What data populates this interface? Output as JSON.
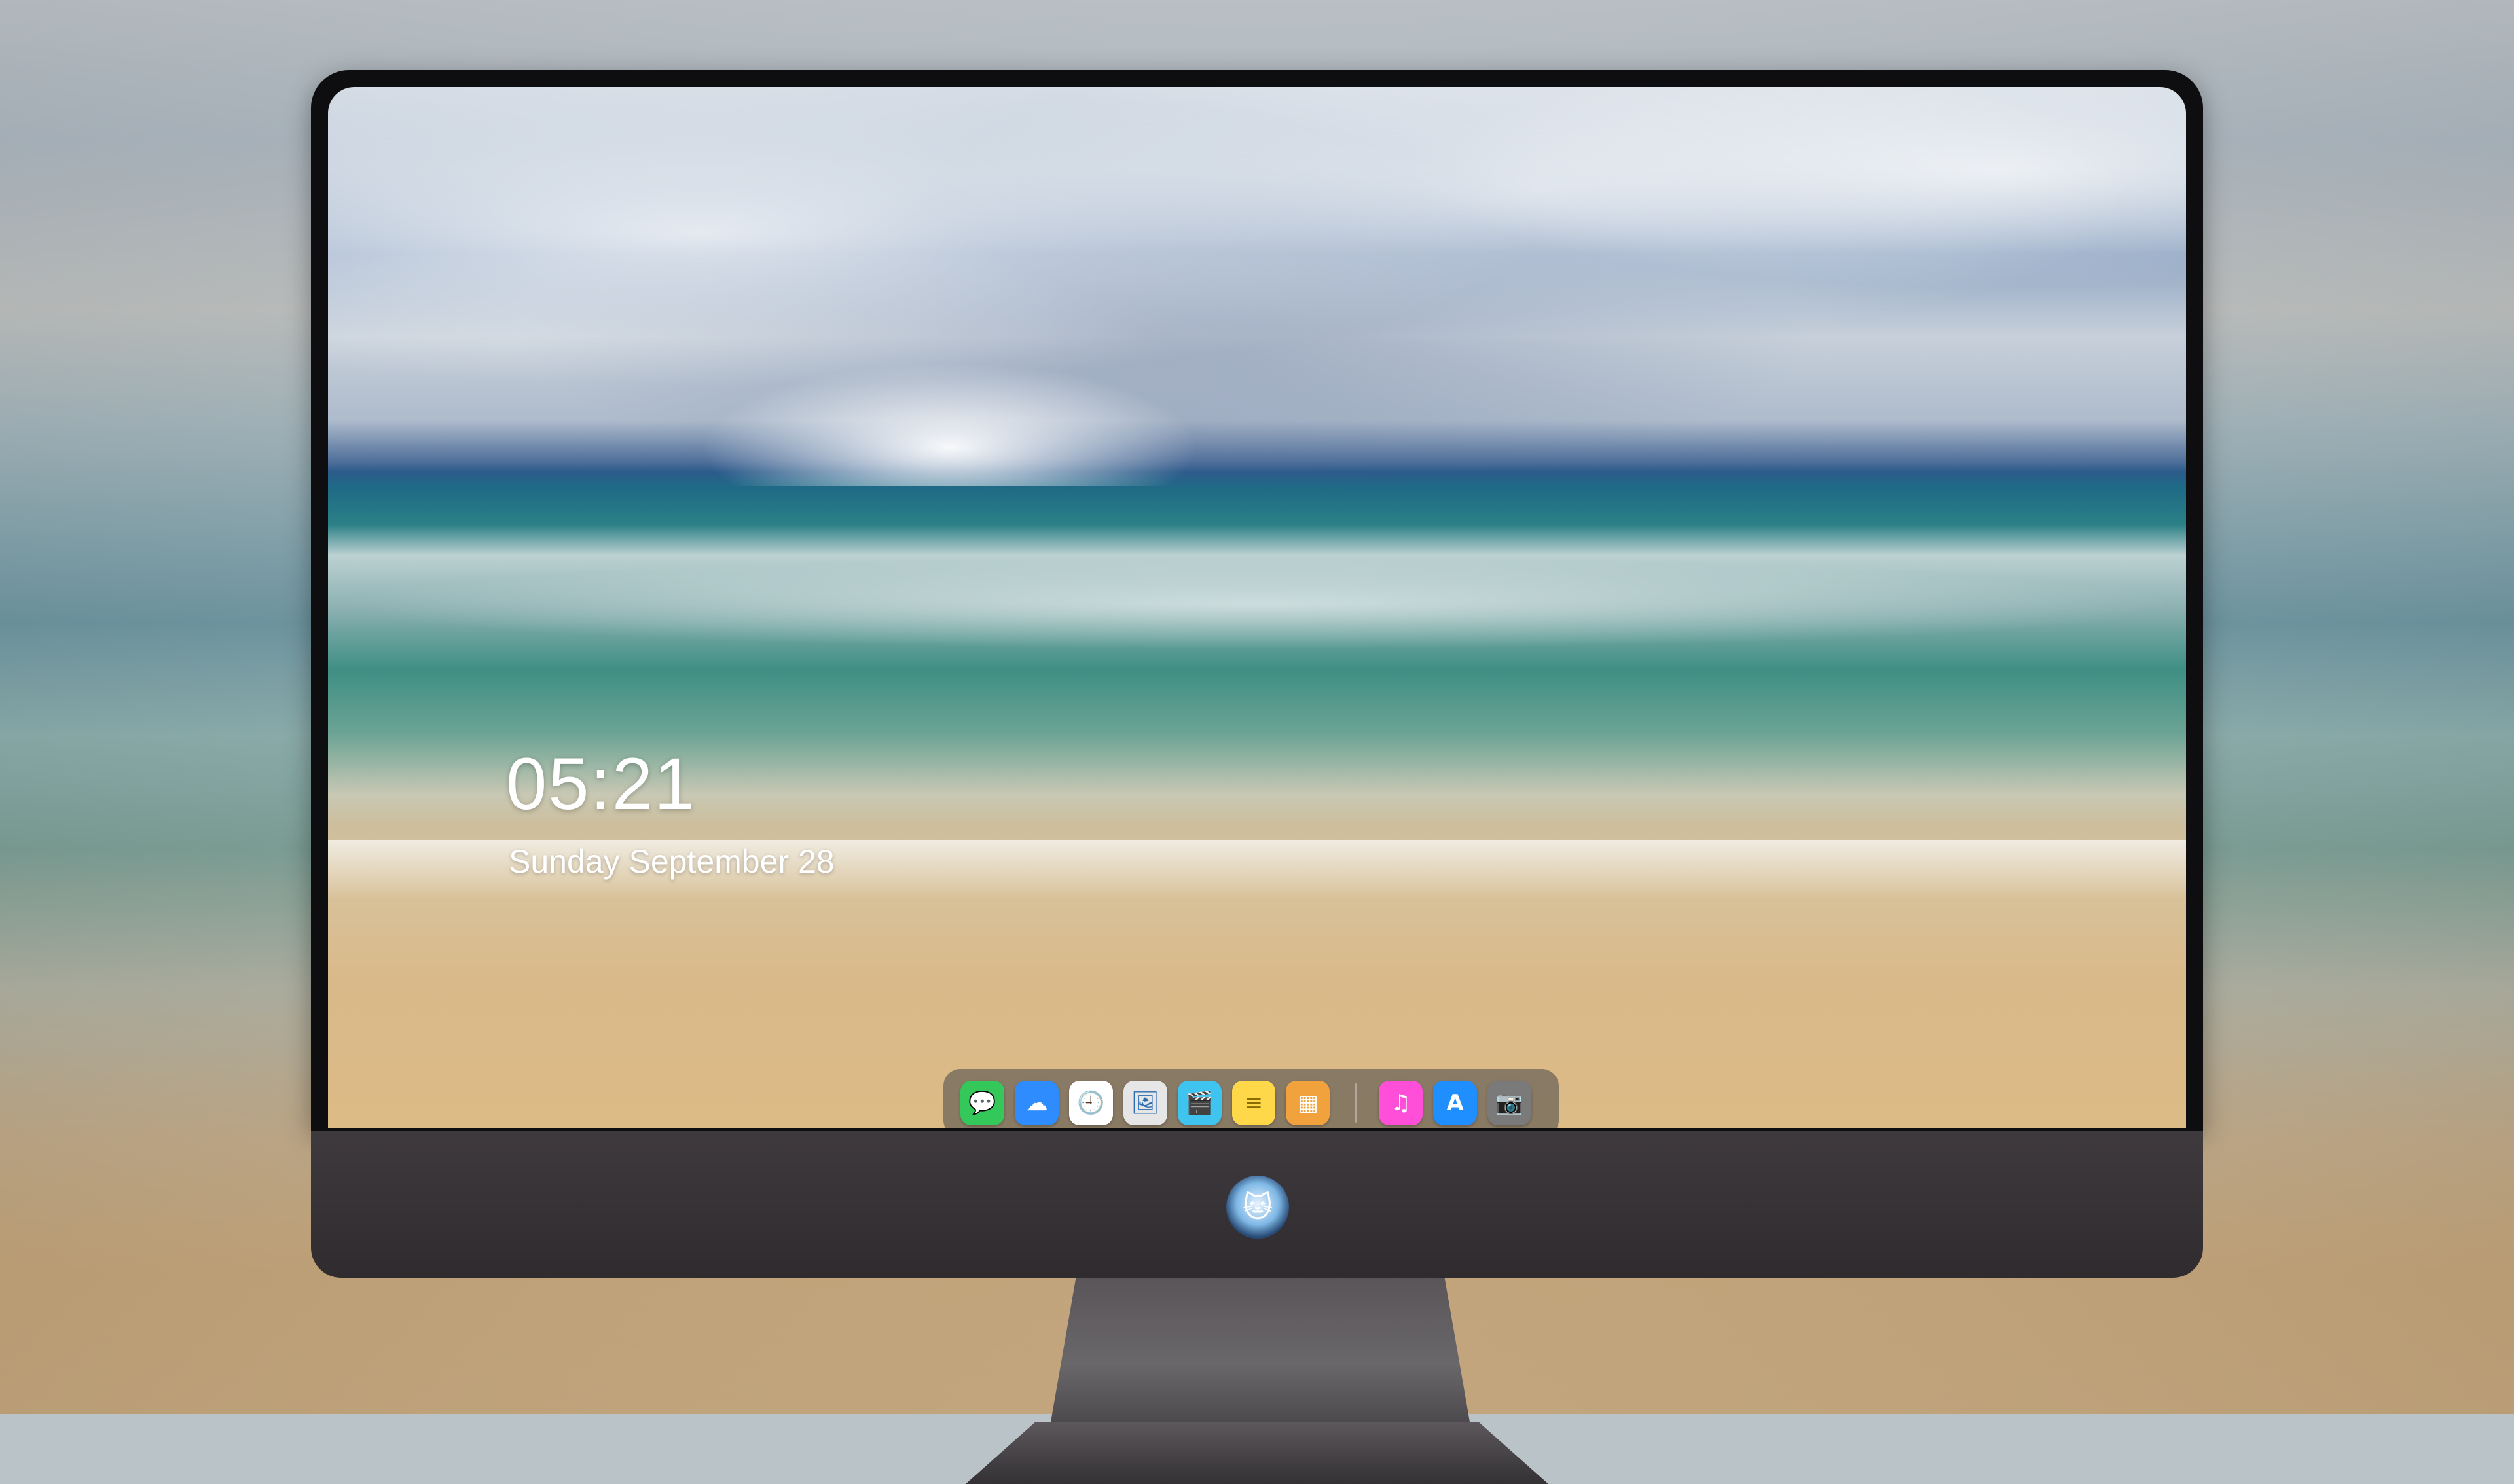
{
  "lock_screen": {
    "time": "05:21",
    "date": "Sunday September 28"
  },
  "dock": {
    "apps": [
      {
        "name": "Messages",
        "icon": "messages-icon",
        "glyph": "💬",
        "color": "#34c759"
      },
      {
        "name": "Weather",
        "icon": "weather-icon",
        "glyph": "☁",
        "color": "#2f8cff"
      },
      {
        "name": "Clock",
        "icon": "clock-icon",
        "glyph": "🕘",
        "color": "#ffffff"
      },
      {
        "name": "Preview",
        "icon": "preview-icon",
        "glyph": "🖼",
        "color": "#e6e6e6"
      },
      {
        "name": "Video",
        "icon": "clapperboard-icon",
        "glyph": "🎬",
        "color": "#3fc4f0"
      },
      {
        "name": "Notes",
        "icon": "notes-icon",
        "glyph": "≡",
        "color": "#ffd84a"
      },
      {
        "name": "Photos Collage",
        "icon": "collage-icon",
        "glyph": "▦",
        "color": "#f2a23c"
      },
      {
        "name": "Music",
        "icon": "music-icon",
        "glyph": "♫",
        "color": "#ff4fd8"
      },
      {
        "name": "App Store",
        "icon": "app-store-icon",
        "glyph": "A",
        "color": "#1f8fff"
      },
      {
        "name": "Camera",
        "icon": "camera-icon",
        "glyph": "📷",
        "color": "#7a7a7a"
      }
    ]
  }
}
